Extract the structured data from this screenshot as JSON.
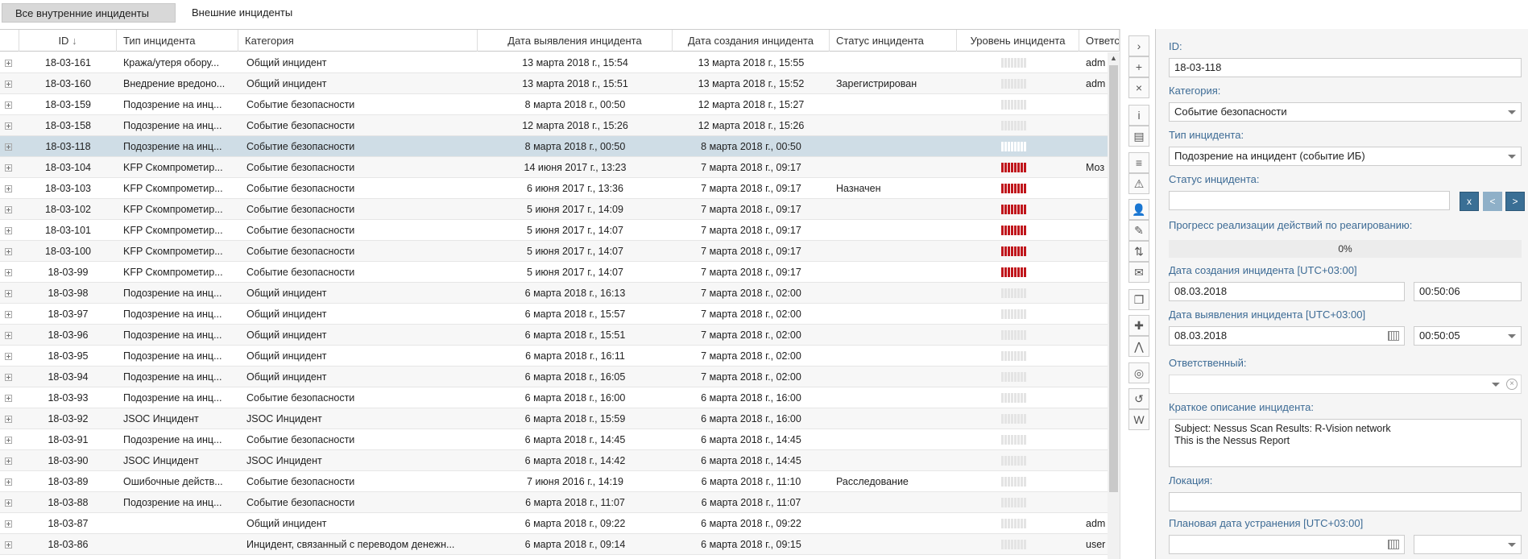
{
  "tabs": [
    {
      "label": "Все внутренние инциденты",
      "active": true
    },
    {
      "label": "Внешние инциденты",
      "active": false
    }
  ],
  "grid": {
    "columns": [
      "ID",
      "Тип инцидента",
      "Категория",
      "Дата выявления инцидента",
      "Дата создания инцидента",
      "Статус инцидента",
      "Уровень инцидента",
      "Ответс"
    ],
    "sort_indicator": "↓",
    "rows": [
      {
        "id": "18-03-161",
        "type": "Кража/утеря обору...",
        "category": "Общий инцидент",
        "detected": "13 марта 2018 г., 15:54",
        "created": "13 марта 2018 г., 15:55",
        "status": "",
        "level": "low",
        "owner": "adm"
      },
      {
        "id": "18-03-160",
        "type": "Внедрение вредоно...",
        "category": "Общий инцидент",
        "detected": "13 марта 2018 г., 15:51",
        "created": "13 марта 2018 г., 15:52",
        "status": "Зарегистрирован",
        "level": "low",
        "owner": "adm"
      },
      {
        "id": "18-03-159",
        "type": "Подозрение на инц...",
        "category": "Событие безопасности",
        "detected": "8 марта 2018 г., 00:50",
        "created": "12 марта 2018 г., 15:27",
        "status": "",
        "level": "low",
        "owner": ""
      },
      {
        "id": "18-03-158",
        "type": "Подозрение на инц...",
        "category": "Событие безопасности",
        "detected": "12 марта 2018 г., 15:26",
        "created": "12 марта 2018 г., 15:26",
        "status": "",
        "level": "low",
        "owner": ""
      },
      {
        "id": "18-03-118",
        "type": "Подозрение на инц...",
        "category": "Событие безопасности",
        "detected": "8 марта 2018 г., 00:50",
        "created": "8 марта 2018 г., 00:50",
        "status": "",
        "level": "low",
        "owner": "",
        "selected": true
      },
      {
        "id": "18-03-104",
        "type": "KFP Скомпрометир...",
        "category": "Событие безопасности",
        "detected": "14 июня 2017 г., 13:23",
        "created": "7 марта 2018 г., 09:17",
        "status": "",
        "level": "high",
        "owner": "Моз"
      },
      {
        "id": "18-03-103",
        "type": "KFP Скомпрометир...",
        "category": "Событие безопасности",
        "detected": "6 июня 2017 г., 13:36",
        "created": "7 марта 2018 г., 09:17",
        "status": "Назначен",
        "level": "high",
        "owner": ""
      },
      {
        "id": "18-03-102",
        "type": "KFP Скомпрометир...",
        "category": "Событие безопасности",
        "detected": "5 июня 2017 г., 14:09",
        "created": "7 марта 2018 г., 09:17",
        "status": "",
        "level": "high",
        "owner": ""
      },
      {
        "id": "18-03-101",
        "type": "KFP Скомпрометир...",
        "category": "Событие безопасности",
        "detected": "5 июня 2017 г., 14:07",
        "created": "7 марта 2018 г., 09:17",
        "status": "",
        "level": "high",
        "owner": ""
      },
      {
        "id": "18-03-100",
        "type": "KFP Скомпрометир...",
        "category": "Событие безопасности",
        "detected": "5 июня 2017 г., 14:07",
        "created": "7 марта 2018 г., 09:17",
        "status": "",
        "level": "high",
        "owner": ""
      },
      {
        "id": "18-03-99",
        "type": "KFP Скомпрометир...",
        "category": "Событие безопасности",
        "detected": "5 июня 2017 г., 14:07",
        "created": "7 марта 2018 г., 09:17",
        "status": "",
        "level": "high",
        "owner": ""
      },
      {
        "id": "18-03-98",
        "type": "Подозрение на инц...",
        "category": "Общий инцидент",
        "detected": "6 марта 2018 г., 16:13",
        "created": "7 марта 2018 г., 02:00",
        "status": "",
        "level": "low",
        "owner": ""
      },
      {
        "id": "18-03-97",
        "type": "Подозрение на инц...",
        "category": "Общий инцидент",
        "detected": "6 марта 2018 г., 15:57",
        "created": "7 марта 2018 г., 02:00",
        "status": "",
        "level": "low",
        "owner": ""
      },
      {
        "id": "18-03-96",
        "type": "Подозрение на инц...",
        "category": "Общий инцидент",
        "detected": "6 марта 2018 г., 15:51",
        "created": "7 марта 2018 г., 02:00",
        "status": "",
        "level": "low",
        "owner": ""
      },
      {
        "id": "18-03-95",
        "type": "Подозрение на инц...",
        "category": "Общий инцидент",
        "detected": "6 марта 2018 г., 16:11",
        "created": "7 марта 2018 г., 02:00",
        "status": "",
        "level": "low",
        "owner": ""
      },
      {
        "id": "18-03-94",
        "type": "Подозрение на инц...",
        "category": "Общий инцидент",
        "detected": "6 марта 2018 г., 16:05",
        "created": "7 марта 2018 г., 02:00",
        "status": "",
        "level": "low",
        "owner": ""
      },
      {
        "id": "18-03-93",
        "type": "Подозрение на инц...",
        "category": "Событие безопасности",
        "detected": "6 марта 2018 г., 16:00",
        "created": "6 марта 2018 г., 16:00",
        "status": "",
        "level": "low",
        "owner": ""
      },
      {
        "id": "18-03-92",
        "type": "JSOC Инцидент",
        "category": "JSOC Инцидент",
        "detected": "6 марта 2018 г., 15:59",
        "created": "6 марта 2018 г., 16:00",
        "status": "",
        "level": "low",
        "owner": ""
      },
      {
        "id": "18-03-91",
        "type": "Подозрение на инц...",
        "category": "Событие безопасности",
        "detected": "6 марта 2018 г., 14:45",
        "created": "6 марта 2018 г., 14:45",
        "status": "",
        "level": "low",
        "owner": ""
      },
      {
        "id": "18-03-90",
        "type": "JSOC Инцидент",
        "category": "JSOC Инцидент",
        "detected": "6 марта 2018 г., 14:42",
        "created": "6 марта 2018 г., 14:45",
        "status": "",
        "level": "low",
        "owner": ""
      },
      {
        "id": "18-03-89",
        "type": "Ошибочные действ...",
        "category": "Событие безопасности",
        "detected": "7 июня 2016 г., 14:19",
        "created": "6 марта 2018 г., 11:10",
        "status": "Расследование",
        "level": "low",
        "owner": ""
      },
      {
        "id": "18-03-88",
        "type": "Подозрение на инц...",
        "category": "Событие безопасности",
        "detected": "6 марта 2018 г., 11:07",
        "created": "6 марта 2018 г., 11:07",
        "status": "",
        "level": "low",
        "owner": ""
      },
      {
        "id": "18-03-87",
        "type": "",
        "category": "Общий инцидент",
        "detected": "6 марта 2018 г., 09:22",
        "created": "6 марта 2018 г., 09:22",
        "status": "",
        "level": "low",
        "owner": "adm"
      },
      {
        "id": "18-03-86",
        "type": "",
        "category": "Инцидент, связанный с переводом денежн...",
        "detected": "6 марта 2018 г., 09:14",
        "created": "6 марта 2018 г., 09:15",
        "status": "",
        "level": "low",
        "owner": "user"
      }
    ]
  },
  "toolbar": {
    "icons": [
      "chevron-right-icon",
      "add-circle-icon",
      "close-icon",
      "info-icon",
      "keyboard-icon",
      "database-icon",
      "warning-icon",
      "user-icon",
      "comment-icon",
      "sort-icon",
      "mail-icon",
      "copy-icon",
      "puzzle-icon",
      "graph-icon",
      "eye-icon",
      "history-icon",
      "word-icon"
    ],
    "glyphs": [
      "›",
      "+",
      "×",
      "i",
      "▤",
      "≡",
      "⚠",
      "👤",
      "✎",
      "⇅",
      "✉",
      "❐",
      "✚",
      "⋀",
      "◎",
      "↺",
      "W"
    ]
  },
  "panel": {
    "id_label": "ID:",
    "id_value": "18-03-118",
    "category_label": "Категория:",
    "category_value": "Событие безопасности",
    "type_label": "Тип инцидента:",
    "type_value": "Подозрение на инцидент (событие ИБ)",
    "status_label": "Статус инцидента:",
    "status_value": "",
    "status_btn_x": "x",
    "status_btn_prev": "<",
    "status_btn_next": ">",
    "progress_label": "Прогресс реализации действий по реагированию:",
    "progress_value": "0%",
    "created_label": "Дата создания инцидента [UTC+03:00]",
    "created_date": "08.03.2018",
    "created_time": "00:50:06",
    "detected_label": "Дата выявления инцидента [UTC+03:00]",
    "detected_date": "08.03.2018",
    "detected_time": "00:50:05",
    "owner_label": "Ответственный:",
    "owner_value": "",
    "description_label": "Краткое описание инцидента:",
    "description_value": "Subject: Nessus Scan Results: R-Vision network\nThis is the Nessus Report",
    "location_label": "Локация:",
    "location_value": "",
    "planned_label": "Плановая дата устранения [UTC+03:00]",
    "planned_date": "",
    "planned_time": ""
  },
  "colors": {
    "accent": "#3d6b95",
    "selected_row": "#cfdde6",
    "level_high": "#c0161c"
  }
}
